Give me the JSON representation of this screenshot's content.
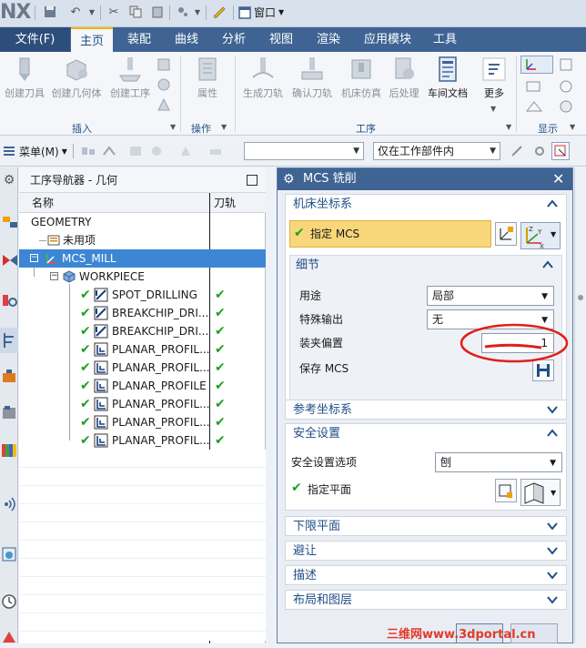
{
  "app": {
    "logo": "NX"
  },
  "titlebar": {
    "window_menu": "窗口"
  },
  "ribbon": {
    "tabs": [
      {
        "label": "文件(F)"
      },
      {
        "label": "主页"
      },
      {
        "label": "装配"
      },
      {
        "label": "曲线"
      },
      {
        "label": "分析"
      },
      {
        "label": "视图"
      },
      {
        "label": "渲染"
      },
      {
        "label": "应用模块"
      },
      {
        "label": "工具"
      }
    ],
    "insert_buttons": [
      {
        "label": "创建刀具"
      },
      {
        "label": "创建几何体"
      },
      {
        "label": "创建工序"
      }
    ],
    "action_buttons": [
      {
        "label": "属性"
      }
    ],
    "operation_buttons": [
      {
        "label": "生成刀轨"
      },
      {
        "label": "确认刀轨"
      },
      {
        "label": "机床仿真"
      },
      {
        "label": "后处理"
      },
      {
        "label": "车间文档"
      },
      {
        "label": "更多"
      }
    ],
    "groups": {
      "insert": "插入",
      "action": "操作",
      "operation": "工序",
      "display": "显示"
    }
  },
  "toolbar2": {
    "menu": "菜单(M)",
    "filter_value": "",
    "scope_value": "仅在工作部件内"
  },
  "navigator": {
    "title": "工序导航器 - 几何",
    "col_name": "名称",
    "col_path": "刀轨",
    "rows": [
      {
        "label": "GEOMETRY"
      },
      {
        "label": "未用项"
      },
      {
        "label": "MCS_MILL"
      },
      {
        "label": "WORKPIECE"
      },
      {
        "label": "SPOT_DRILLING"
      },
      {
        "label": "BREAKCHIP_DRI..."
      },
      {
        "label": "BREAKCHIP_DRI..."
      },
      {
        "label": "PLANAR_PROFIL..."
      },
      {
        "label": "PLANAR_PROFIL..."
      },
      {
        "label": "PLANAR_PROFILE"
      },
      {
        "label": "PLANAR_PROFIL..."
      },
      {
        "label": "PLANAR_PROFIL..."
      },
      {
        "label": "PLANAR_PROFIL..."
      }
    ]
  },
  "dialog": {
    "title": "MCS 铣削",
    "sec_machine": "机床坐标系",
    "specify_mcs": "指定 MCS",
    "sec_detail": "细节",
    "purpose_label": "用途",
    "purpose_value": "局部",
    "special_output_label": "特殊输出",
    "special_output_value": "无",
    "fixture_offset_label": "装夹偏置",
    "fixture_offset_value": "1",
    "save_mcs_label": "保存 MCS",
    "sec_reference": "参考坐标系",
    "sec_safety": "安全设置",
    "safety_option_label": "安全设置选项",
    "safety_option_value": "刨",
    "specify_plane": "指定平面",
    "sec_lower_limit": "下限平面",
    "sec_avoid": "避让",
    "sec_description": "描述",
    "sec_layout": "布局和图层"
  },
  "watermark": "三维网www.3dportal.cn",
  "colors": {
    "ribbon_tab": "#3f6493",
    "selection": "#3d86d4",
    "highlight": "#f8d67a",
    "check": "#20a020",
    "annotation": "#e0201a"
  }
}
